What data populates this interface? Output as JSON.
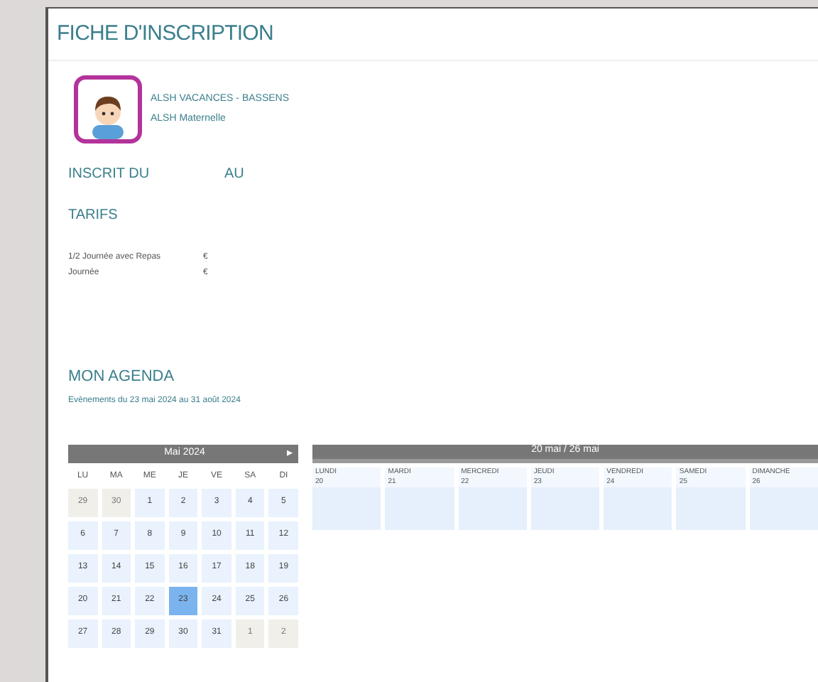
{
  "title": "FICHE D'INSCRIPTION",
  "activity": {
    "name": "ALSH VACANCES - BASSENS",
    "group": "ALSH Maternelle"
  },
  "registration": {
    "from_label": "INSCRIT DU",
    "to_label": "AU"
  },
  "tarifs": {
    "heading": "TARIFS",
    "items": [
      {
        "label": "1/2 Journée avec Repas",
        "price": "€"
      },
      {
        "label": "Journée",
        "price": "€"
      }
    ]
  },
  "agenda": {
    "heading": "MON AGENDA",
    "period": "Evènements du 23 mai 2024 au 31 août 2024"
  },
  "mini_calendar": {
    "month": "Mai 2024",
    "next": "▸",
    "weekdays": [
      "LU",
      "MA",
      "ME",
      "JE",
      "VE",
      "SA",
      "DI"
    ],
    "weeks": [
      [
        {
          "day": "29",
          "other_month": true,
          "selected": false
        },
        {
          "day": "30",
          "other_month": true,
          "selected": false
        },
        {
          "day": "1",
          "other_month": false,
          "selected": false
        },
        {
          "day": "2",
          "other_month": false,
          "selected": false
        },
        {
          "day": "3",
          "other_month": false,
          "selected": false
        },
        {
          "day": "4",
          "other_month": false,
          "selected": false
        },
        {
          "day": "5",
          "other_month": false,
          "selected": false
        }
      ],
      [
        {
          "day": "6",
          "other_month": false,
          "selected": false
        },
        {
          "day": "7",
          "other_month": false,
          "selected": false
        },
        {
          "day": "8",
          "other_month": false,
          "selected": false
        },
        {
          "day": "9",
          "other_month": false,
          "selected": false
        },
        {
          "day": "10",
          "other_month": false,
          "selected": false
        },
        {
          "day": "11",
          "other_month": false,
          "selected": false
        },
        {
          "day": "12",
          "other_month": false,
          "selected": false
        }
      ],
      [
        {
          "day": "13",
          "other_month": false,
          "selected": false
        },
        {
          "day": "14",
          "other_month": false,
          "selected": false
        },
        {
          "day": "15",
          "other_month": false,
          "selected": false
        },
        {
          "day": "16",
          "other_month": false,
          "selected": false
        },
        {
          "day": "17",
          "other_month": false,
          "selected": false
        },
        {
          "day": "18",
          "other_month": false,
          "selected": false
        },
        {
          "day": "19",
          "other_month": false,
          "selected": false
        }
      ],
      [
        {
          "day": "20",
          "other_month": false,
          "selected": false
        },
        {
          "day": "21",
          "other_month": false,
          "selected": false
        },
        {
          "day": "22",
          "other_month": false,
          "selected": false
        },
        {
          "day": "23",
          "other_month": false,
          "selected": true
        },
        {
          "day": "24",
          "other_month": false,
          "selected": false
        },
        {
          "day": "25",
          "other_month": false,
          "selected": false
        },
        {
          "day": "26",
          "other_month": false,
          "selected": false
        }
      ],
      [
        {
          "day": "27",
          "other_month": false,
          "selected": false
        },
        {
          "day": "28",
          "other_month": false,
          "selected": false
        },
        {
          "day": "29",
          "other_month": false,
          "selected": false
        },
        {
          "day": "30",
          "other_month": false,
          "selected": false
        },
        {
          "day": "31",
          "other_month": false,
          "selected": false
        },
        {
          "day": "1",
          "other_month": true,
          "selected": false
        },
        {
          "day": "2",
          "other_month": true,
          "selected": false
        }
      ]
    ]
  },
  "week_view": {
    "range": "20 mai / 26 mai",
    "days": [
      {
        "name": "LUNDI",
        "date": "20"
      },
      {
        "name": "MARDI",
        "date": "21"
      },
      {
        "name": "MERCREDI",
        "date": "22"
      },
      {
        "name": "JEUDI",
        "date": "23"
      },
      {
        "name": "VENDREDI",
        "date": "24"
      },
      {
        "name": "SAMEDI",
        "date": "25"
      },
      {
        "name": "DIMANCHE",
        "date": "26"
      }
    ]
  }
}
